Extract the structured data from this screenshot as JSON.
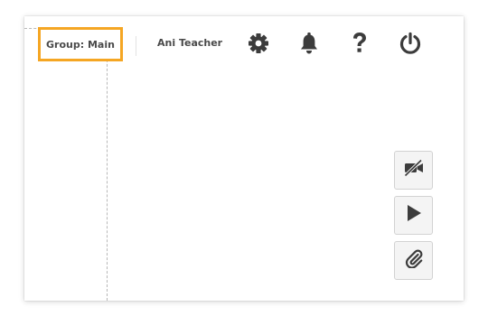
{
  "header": {
    "group_label": "Group: Main",
    "user_name": "Ani Teacher"
  },
  "icons": {
    "settings": "gear-icon",
    "notifications": "bell-icon",
    "help": "question-mark-icon",
    "logout": "power-icon"
  },
  "side_controls": [
    {
      "icon": "video-off-icon"
    },
    {
      "icon": "play-icon"
    },
    {
      "icon": "paperclip-icon"
    }
  ],
  "colors": {
    "highlight": "#f5a623",
    "icon": "#3c3c3c",
    "text": "#4a4a4a"
  }
}
